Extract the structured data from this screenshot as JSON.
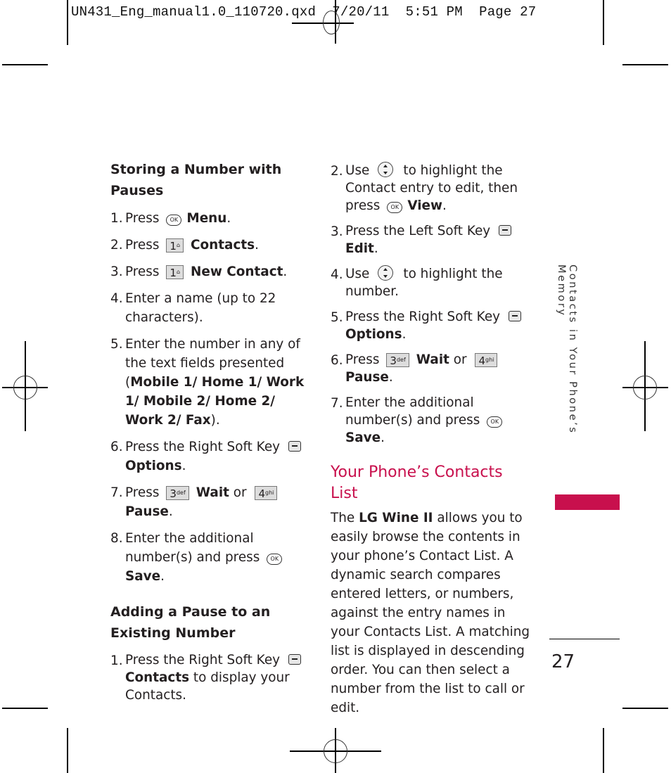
{
  "slug": "UN431_Eng_manual1.0_110720.qxd  7/20/11  5:51 PM  Page 27",
  "side_tab": "Contacts in Your Phone’s Memory",
  "page_number": "27",
  "accent_color": "#c8104d",
  "col1": {
    "heading1": "Storing a Number with Pauses",
    "steps1": [
      {
        "num": "1.",
        "pre": "Press",
        "icon": "ok-key-icon",
        "bold": "Menu",
        "post": "."
      },
      {
        "num": "2.",
        "pre": "Press",
        "key": "1",
        "key_sub": "",
        "bold": "Contacts",
        "post": "."
      },
      {
        "num": "3.",
        "pre": "Press",
        "key": "1",
        "key_sub": "",
        "bold": "New Contact",
        "post": "."
      },
      {
        "num": "4.",
        "text": "Enter a name (up to 22 characters)."
      },
      {
        "num": "5.",
        "pre": "Enter the number in any of the text fields presented (",
        "bold": "Mobile 1/ Home 1/ Work 1/ Mobile 2/ Home 2/ Work 2/ Fax",
        "post": ")."
      },
      {
        "num": "6.",
        "pre": "Press the Right Soft Key",
        "icon": "right-soft-key-icon",
        "bold": "Options",
        "post": "."
      },
      {
        "num": "7.",
        "pre": "Press",
        "key_a": "3",
        "key_a_sub": "def",
        "bold_a": "Wait",
        "mid": " or ",
        "key_b": "4",
        "key_b_sub": "ghi",
        "bold_b": "Pause",
        "post": "."
      },
      {
        "num": "8.",
        "pre": "Enter the additional number(s) and press",
        "icon": "ok-key-icon",
        "bold": "Save",
        "post": "."
      }
    ],
    "heading2": "Adding a Pause to an Existing Number",
    "steps2": [
      {
        "num": "1.",
        "pre": "Press the Right Soft Key",
        "icon": "right-soft-key-icon",
        "bold": "Contacts",
        "post": " to display your Contacts."
      }
    ]
  },
  "col2": {
    "steps": [
      {
        "num": "2.",
        "pre": "Use",
        "icon": "nav-key-icon",
        "mid": "to highlight the Contact entry to edit, then press",
        "icon2": "ok-key-icon",
        "bold": "View",
        "post": "."
      },
      {
        "num": "3.",
        "pre": "Press the Left Soft Key",
        "icon": "left-soft-key-icon",
        "bold": "Edit",
        "post": "."
      },
      {
        "num": "4.",
        "pre": "Use",
        "icon": "nav-key-icon",
        "mid": "to highlight the number."
      },
      {
        "num": "5.",
        "pre": "Press the Right Soft Key",
        "icon": "right-soft-key-icon",
        "bold": "Options",
        "post": "."
      },
      {
        "num": "6.",
        "pre": "Press",
        "key_a": "3",
        "key_a_sub": "def",
        "bold_a": "Wait",
        "mid": " or ",
        "key_b": "4",
        "key_b_sub": "ghi",
        "bold_b": "Pause",
        "post": "."
      },
      {
        "num": "7.",
        "pre": "Enter the additional number(s) and press",
        "icon": "ok-key-icon",
        "bold": "Save",
        "post": "."
      }
    ],
    "section_title": "Your Phone’s Contacts List",
    "para_pre": "The ",
    "para_bold": "LG Wine II",
    "para_post": " allows you to easily browse the contents in your phone’s Contact List. A dynamic search compares entered letters, or numbers, against the entry names in your Contacts List. A matching list is displayed in descending order. You can then select a number from the list to call or edit."
  },
  "icons": {
    "ok_label": "OK",
    "contacts_key_glyph": "⌂"
  }
}
